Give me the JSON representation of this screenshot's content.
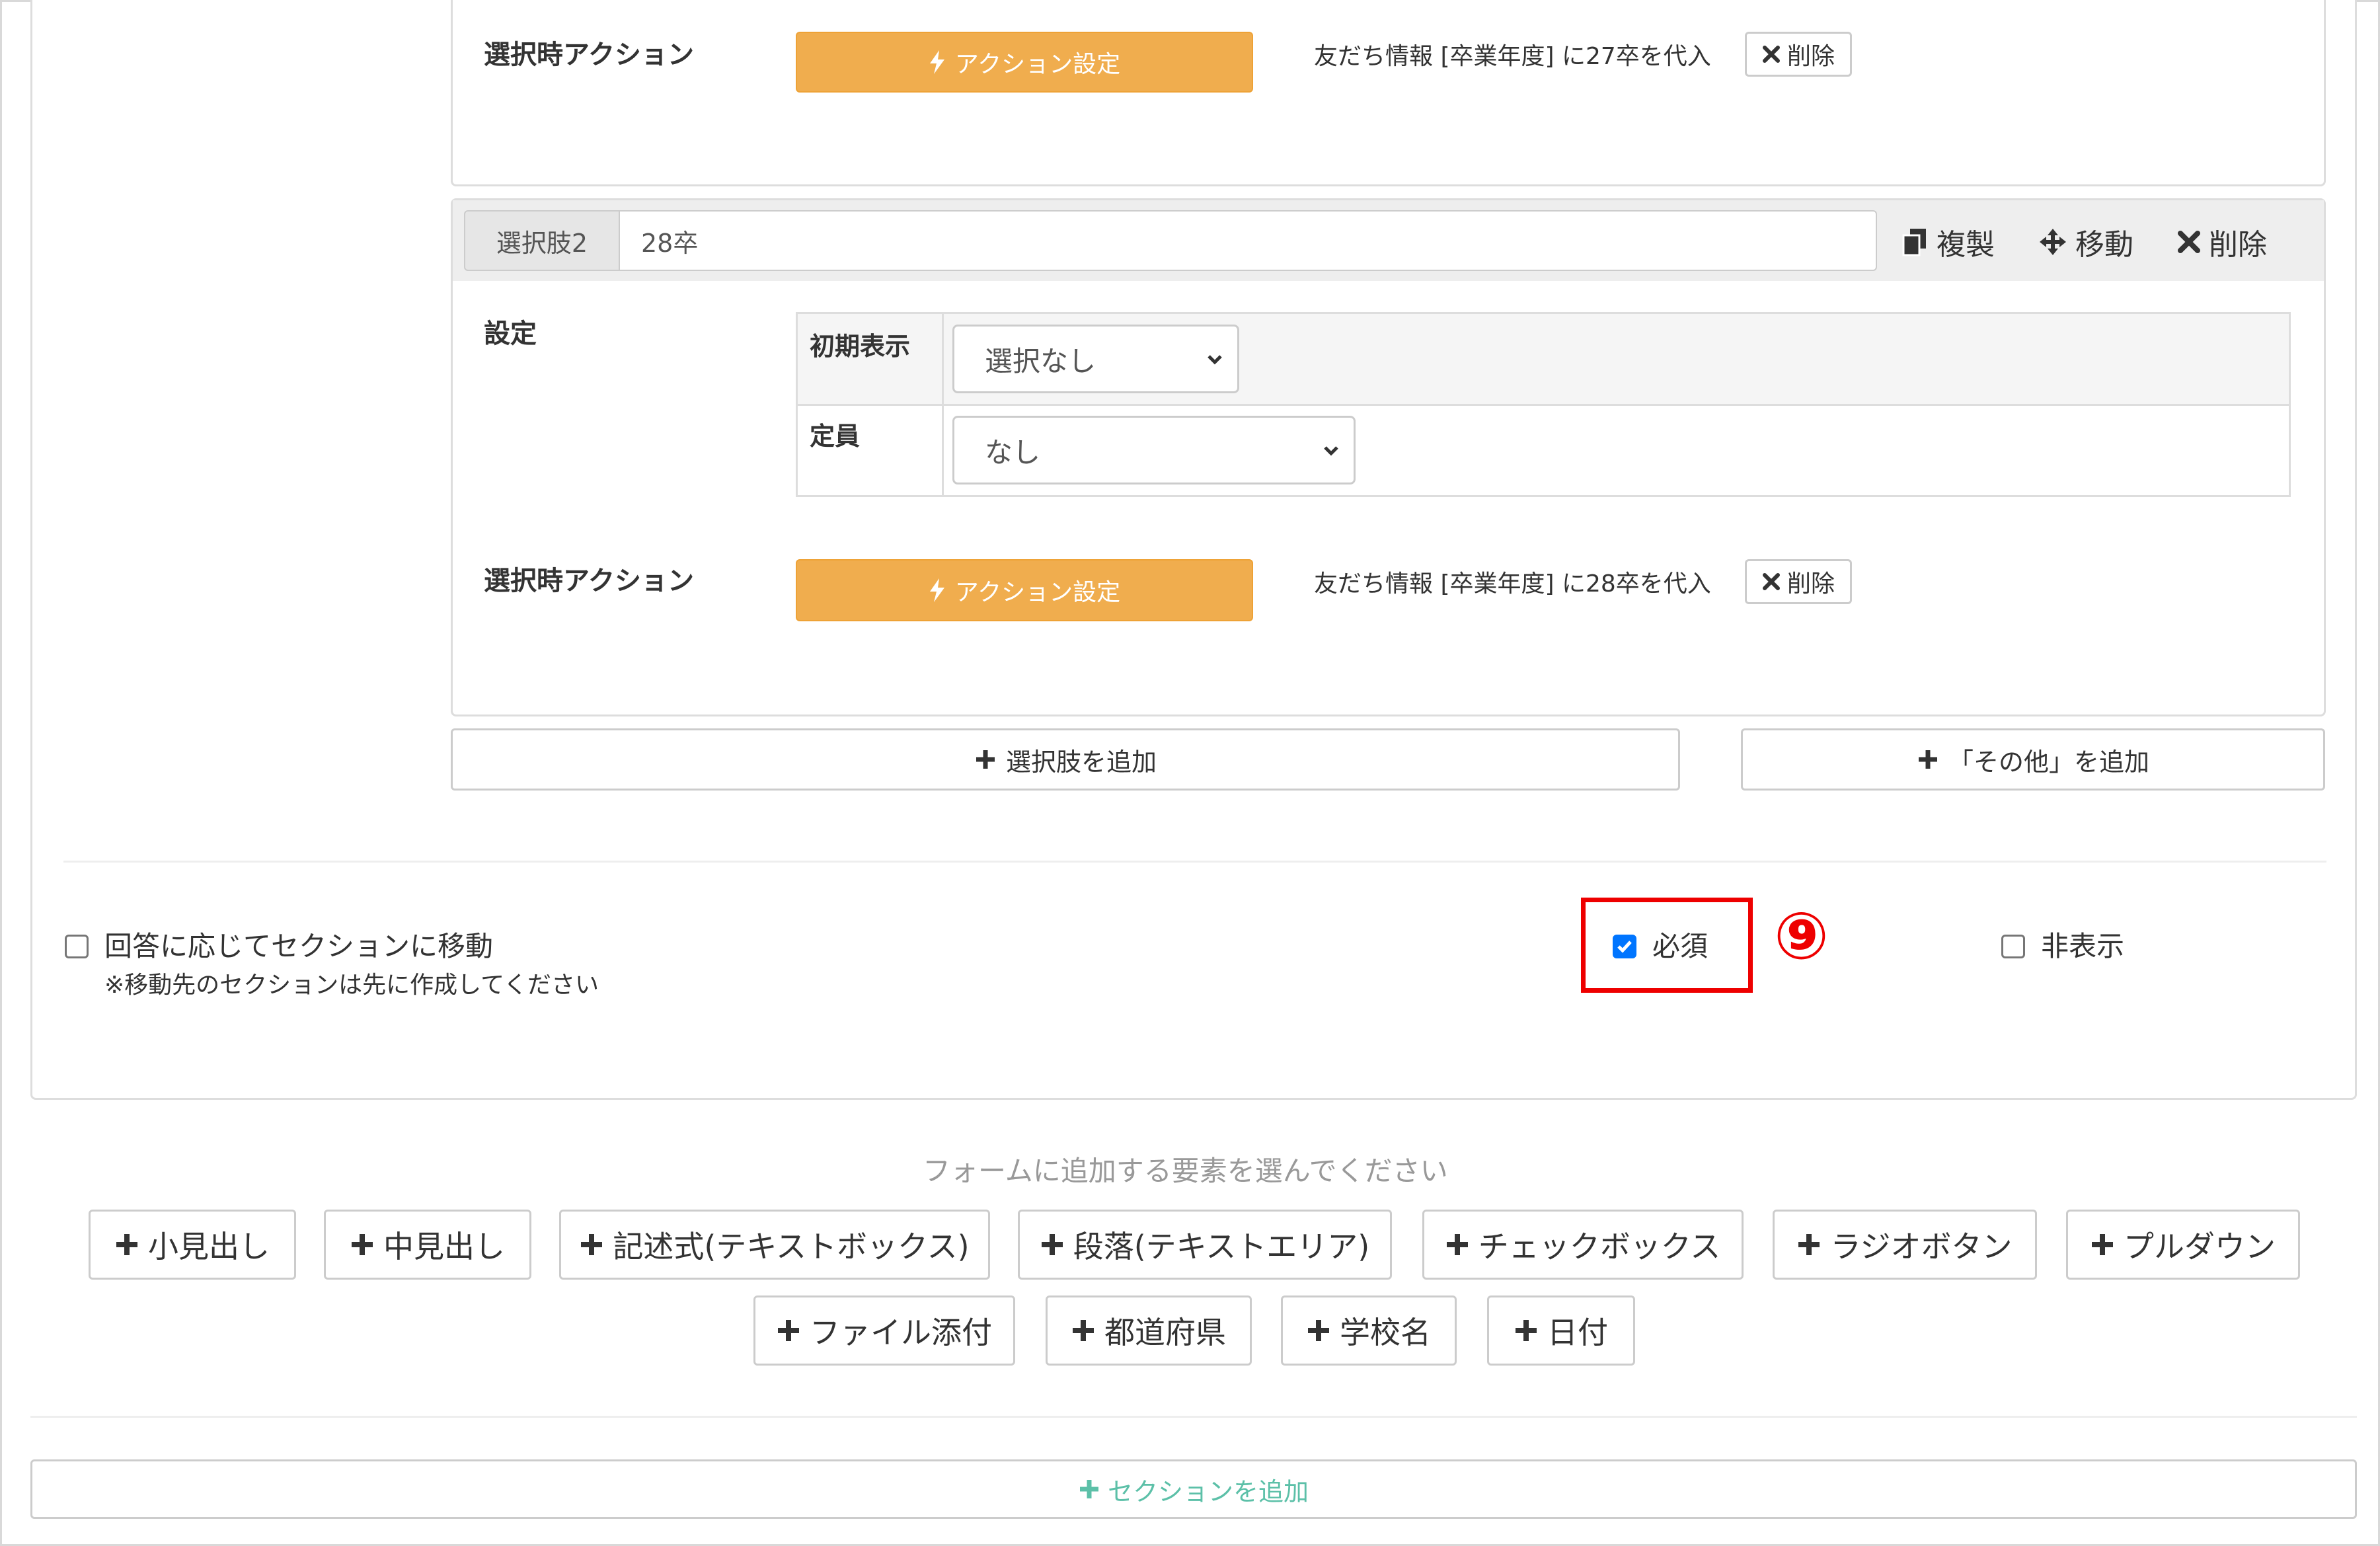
{
  "choice1": {
    "action_label": "選択時アクション",
    "action_button_label": "アクション設定",
    "action_text": "友だち情報 [卒業年度] に27卒を代入",
    "delete_label": "削除"
  },
  "choice2": {
    "prefix": "選択肢2",
    "value": "28卒",
    "copy_label": "複製",
    "move_label": "移動",
    "delete_label": "削除",
    "settings_label": "設定",
    "initial_display_label": "初期表示",
    "initial_display_value": "選択なし",
    "capacity_label": "定員",
    "capacity_value": "なし",
    "action_label": "選択時アクション",
    "action_button_label": "アクション設定",
    "action_text": "友だち情報 [卒業年度] に28卒を代入",
    "action_delete_label": "削除"
  },
  "add_choice_label": "選択肢を追加",
  "add_other_label": "「その他」を追加",
  "options": {
    "section_jump_label": "回答に応じてセクションに移動",
    "section_jump_note": "※移動先のセクションは先に作成してください",
    "section_jump_checked": false,
    "required_label": "必須",
    "required_checked": true,
    "hidden_label": "非表示",
    "hidden_checked": false
  },
  "annotation_badge": "⑨",
  "add_element_hint": "フォームに追加する要素を選んでください",
  "elements_row1": [
    "小見出し",
    "中見出し",
    "記述式(テキストボックス)",
    "段落(テキストエリア)",
    "チェックボックス",
    "ラジオボタン",
    "プルダウン"
  ],
  "elements_row2": [
    "ファイル添付",
    "都道府県",
    "学校名",
    "日付"
  ],
  "add_section_label": "セクションを追加",
  "icons": {
    "bolt": "bolt-icon",
    "times": "times-icon",
    "copy": "copy-icon",
    "move": "arrows-icon",
    "plus": "plus-icon",
    "chevron": "chevron-down-icon",
    "check": "check-icon"
  },
  "colors": {
    "orange": "#f0ad4e",
    "red_annotation": "#ee0000",
    "teal": "#5cc0a8",
    "checkbox_blue": "#0075ff"
  }
}
